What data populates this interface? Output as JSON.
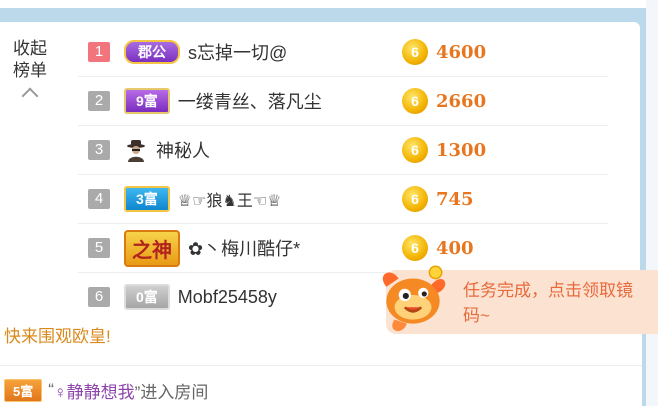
{
  "panel": {
    "collapse_label_1": "收起",
    "collapse_label_2": "榜单"
  },
  "ranking": [
    {
      "rank": "1",
      "badge": "郡公",
      "badge_style": "gong",
      "name": "s忘掉一切@",
      "score": "4600",
      "coin_label": "6"
    },
    {
      "rank": "2",
      "badge": "9富",
      "badge_style": "fu9",
      "name": "一缕青丝、落凡尘",
      "score": "2660",
      "coin_label": "6"
    },
    {
      "rank": "3",
      "badge": "",
      "badge_style": "spy",
      "icon": "spy-icon",
      "name": "神秘人",
      "score": "1300",
      "coin_label": "6"
    },
    {
      "rank": "4",
      "badge": "3富",
      "badge_style": "fu3",
      "name": "♕☞狼♞王☜♕",
      "score": "745",
      "coin_label": "6"
    },
    {
      "rank": "5",
      "badge": "之神",
      "badge_style": "god",
      "name": "✿丶梅川酷仔*",
      "score": "400",
      "coin_label": "6"
    },
    {
      "rank": "6",
      "badge": "0富",
      "badge_style": "fu0",
      "name": "Mobf25458y",
      "score": "",
      "coin_label": ""
    }
  ],
  "toast": {
    "message_line1": "任务完成，点击领取镜",
    "message_line2": "码~"
  },
  "chat": {
    "line1": "快来围观欧皇!",
    "line2_badge": "5富",
    "line2_quote_open": "“",
    "line2_user": "♀静静想我",
    "line2_suffix": "”进入房间"
  },
  "colors": {
    "accent_orange": "#e8761f",
    "rank_first": "#f2747c",
    "rank_default": "#aaaaaa",
    "toast_bg": "#fbe2d1"
  }
}
